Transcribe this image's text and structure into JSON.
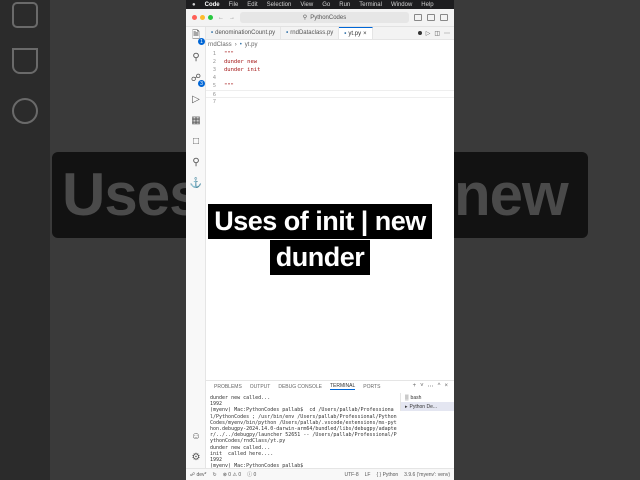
{
  "menubar": {
    "app": "Code",
    "items": [
      "File",
      "Edit",
      "Selection",
      "View",
      "Go",
      "Run",
      "Terminal",
      "Window",
      "Help"
    ]
  },
  "titlebar": {
    "search_text": "PythonCodes"
  },
  "tabs": [
    {
      "label": "denominationCount.py"
    },
    {
      "label": "rndDataclass.py"
    },
    {
      "label": "yt.py"
    }
  ],
  "breadcrumb": {
    "folder": "rndClass",
    "file": "yt.py"
  },
  "editor": {
    "lines": [
      {
        "no": "1",
        "text": "\"\"\""
      },
      {
        "no": "2",
        "text": "dunder new"
      },
      {
        "no": "3",
        "text": "dunder init"
      },
      {
        "no": "4",
        "text": ""
      },
      {
        "no": "5",
        "text": "\"\"\""
      },
      {
        "no": "6",
        "text": ""
      },
      {
        "no": "7",
        "text": ""
      }
    ]
  },
  "panel": {
    "tabs": [
      "PROBLEMS",
      "OUTPUT",
      "DEBUG CONSOLE",
      "TERMINAL",
      "PORTS"
    ],
    "terminal_text": "dunder new called...\n1992\n(myenv) Mac:PythonCodes pallab$  cd /Users/pallab/Professional/PythonCodes ; /usr/bin/env /Users/pallab/Professional/PythonCodes/myenv/bin/python /Users/pallab/.vscode/extensions/ms-python.debugpy-2024.14.0-darwin-arm64/bundled/libs/debugpy/adapter/../../debugpy/launcher 52651 -- /Users/pallab/Professional/PythonCodes/rndClass/yt.py\ndunder new called...\ninit  called here....\n1992\n(myenv) Mac:PythonCodes pallab$ ",
    "terminals": [
      "bash",
      "Python De..."
    ]
  },
  "status": {
    "branch": "dev*",
    "problems": "0",
    "warnings": "0",
    "info": "0",
    "encoding": "UTF-8",
    "eol": "LF",
    "language": "Python",
    "interpreter": "3.9.6 ('myenv': venv)"
  },
  "caption": {
    "line1": "Uses of init | new",
    "line2": "dunder"
  },
  "background": {
    "banner_left": "Uses",
    "banner_right": "new"
  }
}
